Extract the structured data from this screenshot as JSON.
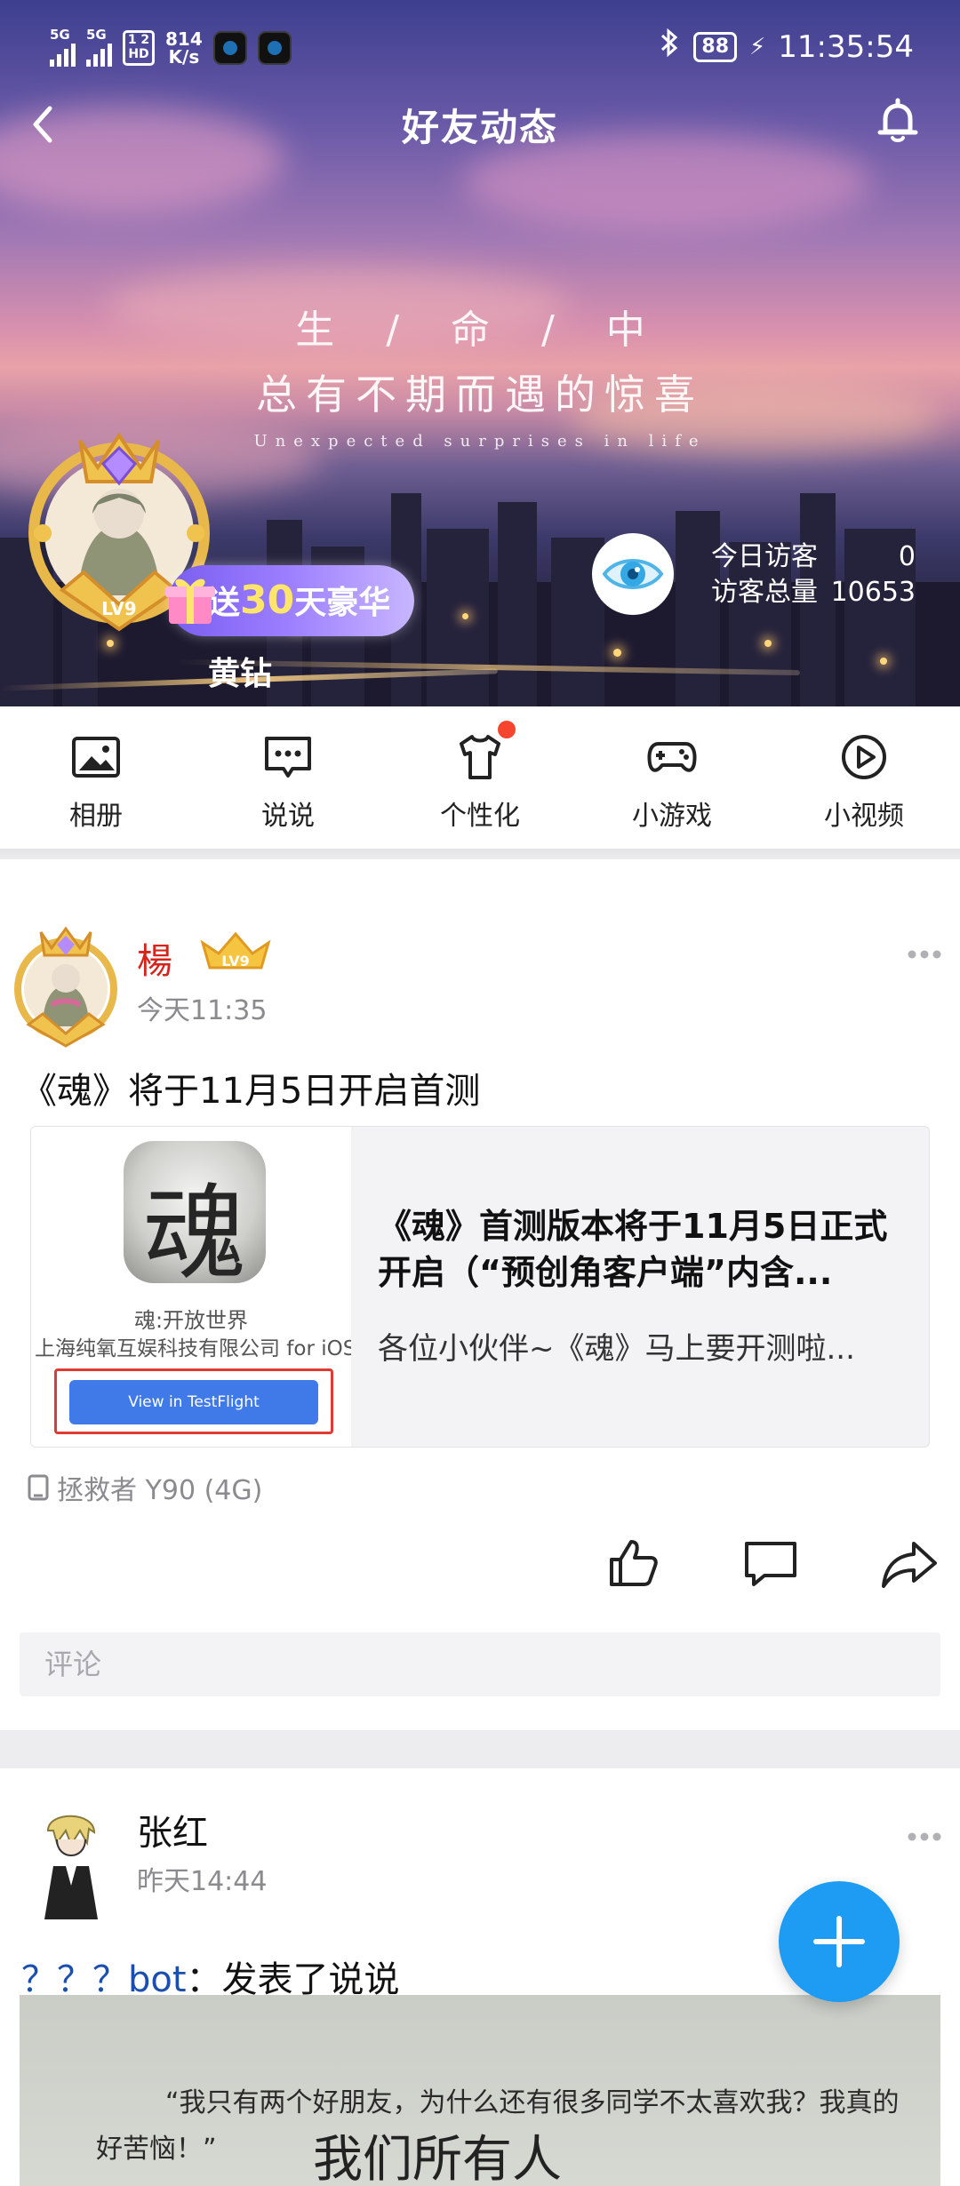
{
  "status_bar": {
    "sig1": "5G",
    "sig2": "5G",
    "hd_top": "1 2",
    "hd_bottom": "HD",
    "speed_value": "814",
    "speed_unit": "K/s",
    "battery": "88",
    "time": "11:35:54"
  },
  "nav": {
    "title": "好友动态"
  },
  "banner": {
    "slogan_line1": "生 / 命 / 中",
    "slogan_line2": "总有不期而遇的惊喜",
    "slogan_line3": "Unexpected surprises in life",
    "level_badge": "LV9",
    "promo_prefix": "送",
    "promo_number": "30",
    "promo_suffix": "天豪华黄钻",
    "visitors_today_label": "今日访客",
    "visitors_today_value": "0",
    "visitors_total_label": "访客总量",
    "visitors_total_value": "10653"
  },
  "shortcuts": [
    {
      "label": "相册",
      "icon": "image-icon"
    },
    {
      "label": "说说",
      "icon": "message-icon"
    },
    {
      "label": "个性化",
      "icon": "tshirt-icon"
    },
    {
      "label": "小游戏",
      "icon": "gamepad-icon"
    },
    {
      "label": "小视频",
      "icon": "play-icon"
    }
  ],
  "post1": {
    "author": "楊",
    "level": "LV9",
    "time": "今天11:35",
    "text": "《魂》将于11月5日开启首测",
    "link": {
      "app_icon_glyph": "魂",
      "app_name": "魂:开放世界",
      "app_company": "上海纯氧互娱科技有限公司 for iOS",
      "testflight_button": "View in TestFlight",
      "title": "《魂》首测版本将于11月5日正式开启（“预创角客户端”内含...",
      "desc": "各位小伙伴~《魂》马上要开测啦..."
    },
    "device": "拯救者 Y90 (4G)",
    "comment_placeholder": "评论"
  },
  "post2": {
    "author": "张红",
    "time": "昨天14:44",
    "text_mention": "？？？bot",
    "text_rest": "：发表了说说",
    "photo_line1": "“我只有两个好朋友，为什么还有很多同学不太喜欢我？我真的",
    "photo_line2": "好苦恼！”",
    "photo_handwriting": "我们所有人"
  },
  "colors": {
    "accent_blue": "#1e9bf3",
    "username_red": "#d6231c",
    "red_dot": "#f5452e",
    "testflight_blue": "#3f7ae8"
  }
}
